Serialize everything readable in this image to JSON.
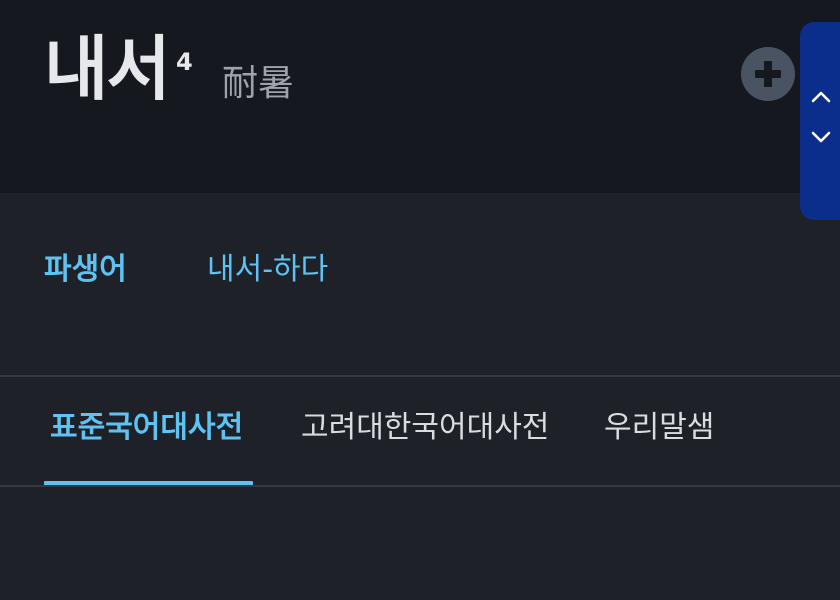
{
  "entry": {
    "headword": "내서",
    "homonym_number": "4",
    "hanja": "耐暑"
  },
  "icons": {
    "add": "plus-circle-icon",
    "scroll_up": "chevron-up-icon",
    "scroll_down": "chevron-down-icon"
  },
  "derivative": {
    "label": "파생어",
    "word": "내서-하다"
  },
  "tabs": [
    {
      "label": "표준국어대사전",
      "active": true
    },
    {
      "label": "고려대한국어대사전",
      "active": false
    },
    {
      "label": "우리말샘",
      "active": false
    }
  ],
  "colors": {
    "accent": "#5ec2f2",
    "header_bg": "#15181e",
    "page_bg": "#1e2128",
    "scroll_control_bg": "#0b2d8c",
    "add_button_bg": "#4a5362"
  }
}
